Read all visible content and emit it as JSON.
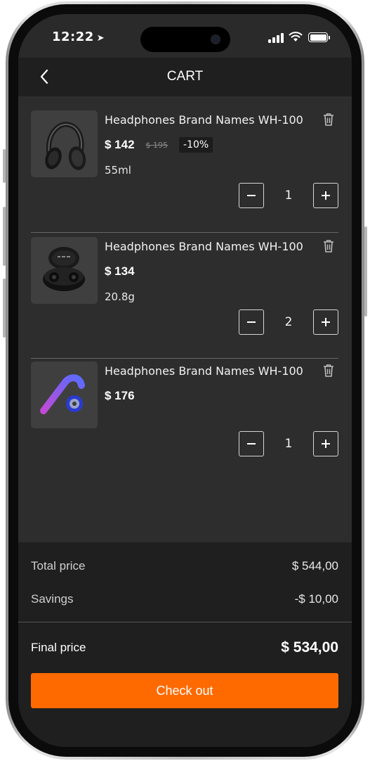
{
  "status_bar": {
    "time": "12:22"
  },
  "header": {
    "title": "CART"
  },
  "items": [
    {
      "name": "Headphones Brand Names WH-100",
      "price": "$ 142",
      "old_price": "$ 195",
      "discount": "-10%",
      "variant": "55ml",
      "quantity": "1",
      "image": "over-ear-headphones"
    },
    {
      "name": "Headphones Brand Names WH-100",
      "price": "$ 134",
      "variant": "20.8g",
      "quantity": "2",
      "image": "wireless-earbuds-case"
    },
    {
      "name": "Headphones Brand Names WH-100",
      "price": "$ 176",
      "quantity": "1",
      "image": "bluetooth-earpiece"
    }
  ],
  "summary": {
    "total_label": "Total price",
    "total_value": "$ 544,00",
    "savings_label": "Savings",
    "savings_value": "-$ 10,00",
    "final_label": "Final price",
    "final_value": "$ 534,00"
  },
  "checkout_label": "Check out",
  "colors": {
    "accent": "#ff6a00",
    "background": "#2d2d2d",
    "panel": "#1f1f1f"
  }
}
